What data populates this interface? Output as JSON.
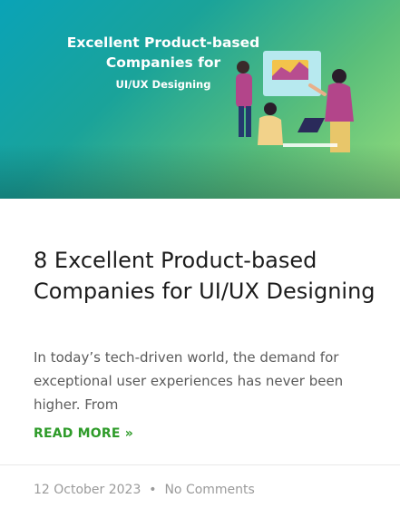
{
  "hero": {
    "line1": "Excellent Product-based",
    "line2": "Companies for",
    "subtitle": "UI/UX Designing"
  },
  "post": {
    "title": "8 Excellent Product-based Companies for UI/UX Designing",
    "excerpt": "In today’s tech-driven world, the demand for exceptional user experiences has never been higher. From",
    "read_more": "READ MORE »",
    "date": "12 October 2023",
    "separator": "•",
    "comments": "No Comments"
  },
  "colors": {
    "accent_green": "#2e9b29",
    "hero_start": "#0aa3b7",
    "hero_end": "#93dc7c"
  }
}
